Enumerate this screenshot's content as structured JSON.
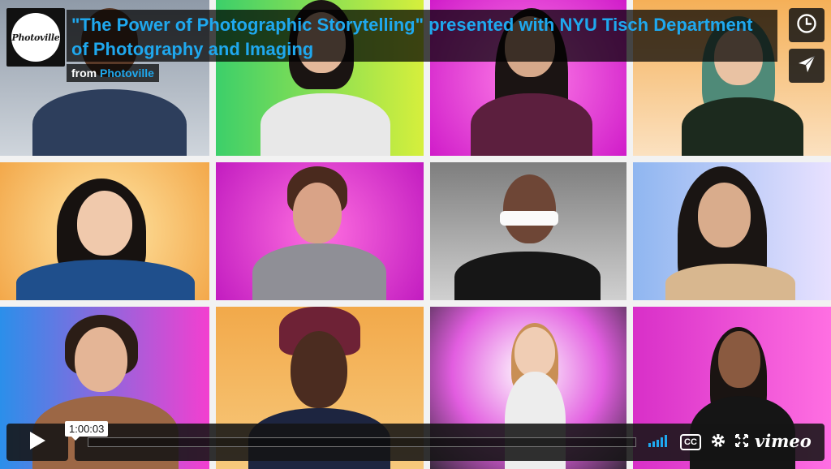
{
  "video": {
    "title": "\"The Power of Photographic Storytelling\" presented with NYU Tisch Department of Photography and Imaging",
    "byline_prefix": "from",
    "owner": "Photoville",
    "logo_text": "Photoville",
    "timecode": "1:00:03",
    "progress": 0.0
  },
  "side_buttons": [
    {
      "name": "watch-later",
      "icon": "clock-icon"
    },
    {
      "name": "share",
      "icon": "paper-plane-icon"
    }
  ],
  "controls": {
    "play_icon": "play-icon",
    "volume_icon": "volume-bars-icon",
    "cc_label": "CC",
    "settings_icon": "gear-icon",
    "fullscreen_icon": "fullscreen-icon",
    "brand_label": "vimeo"
  },
  "colors": {
    "accent": "#1fa8ee",
    "overlay": "#141414"
  }
}
